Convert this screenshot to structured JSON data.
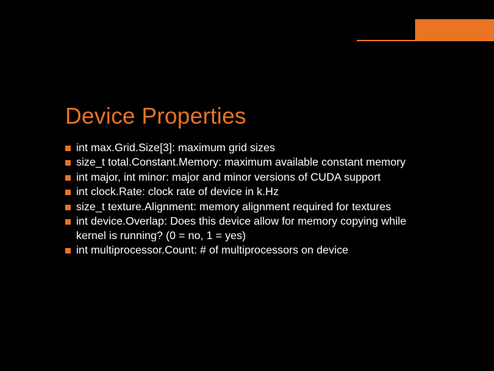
{
  "title": "Device Properties",
  "bullets": [
    "int max.Grid.Size[3]: maximum grid sizes",
    "size_t total.Constant.Memory: maximum available constant memory",
    "int major, int minor: major and minor versions of CUDA support",
    "int clock.Rate: clock rate of device in k.Hz",
    "size_t texture.Alignment: memory alignment required for textures",
    "int device.Overlap: Does this device allow for memory copying while kernel is running? (0 = no, 1 = yes)",
    "int multiprocessor.Count: # of multiprocessors on device"
  ]
}
